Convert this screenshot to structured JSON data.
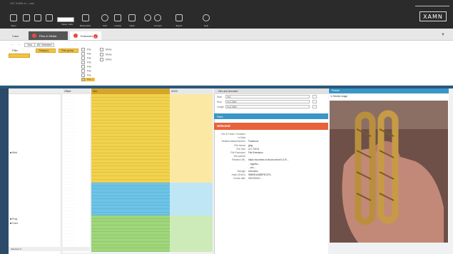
{
  "window": {
    "title": "XRY  XAMN 4.x  -  case"
  },
  "logo": "XAMN",
  "ribbon": {
    "buttons": [
      {
        "label": "Open"
      },
      {
        "label": ""
      },
      {
        "label": ""
      },
      {
        "label": "Views / tabs"
      },
      {
        "label": "Bookmarks"
      },
      {
        "label": "Find"
      },
      {
        "label": "Lookup"
      },
      {
        "label": "Hash"
      },
      {
        "label": "Convert"
      },
      {
        "label": "Export"
      },
      {
        "label": "Help"
      }
    ]
  },
  "tabs": {
    "home": "Case",
    "files": "Files & Media",
    "extended": "Extended 1"
  },
  "top_panel": {
    "nav": [
      "Back",
      "Forward"
    ],
    "buttons": [
      "Turn",
      "All / Selected"
    ],
    "filters": [
      "Filter",
      "Category",
      "Files group"
    ],
    "tree": [
      "File",
      "File",
      "File",
      "File",
      "File",
      "File",
      "File",
      "File",
      "File",
      "File 2"
    ],
    "right_tree": [
      "Mime",
      "Mime",
      "Mime"
    ]
  },
  "hex": {
    "column_header": "Offset",
    "hex_header": "Hex",
    "ascii_header": "ASCII"
  },
  "left_list": {
    "items": [
      "Mint",
      "Prop",
      "Cred"
    ]
  },
  "inspector": {
    "header": "Hex and decoded",
    "rows": [
      {
        "label": "Start",
        "value": "0x0"
      },
      {
        "label": "Stop",
        "value": "0x1CB84"
      },
      {
        "label": "Length",
        "value": "0x1CB85"
      }
    ],
    "file_bar": "Files",
    "selected_bar": "Selected",
    "details": [
      {
        "key": "File & Folder / Duration",
        "value": ""
      },
      {
        "key": "Is Data",
        "value": ""
      },
      {
        "key": "Related Attachment/url",
        "value": "Facebook"
      },
      {
        "key": "File format",
        "value": "jpeg"
      },
      {
        "key": "File Size",
        "value": "117,700 B"
      },
      {
        "key": "File Extension",
        "value": "File Extension"
      },
      {
        "key": "Recovered",
        "value": ""
      },
      {
        "key": "Related URL",
        "value": "https://scontent.xx.fbcdn.net/v/t1.0-9/..."
      },
      {
        "key": "",
        "value": "...mgcfhc..."
      },
      {
        "key": "",
        "value": "...oh=..."
      },
      {
        "key": "Storage",
        "value": "Unknown"
      },
      {
        "key": "Hash (SHA1)",
        "value": "96B9E4148BF5C2F4..."
      },
      {
        "key": "Create date",
        "value": "2017/02/10 ..."
      }
    ]
  },
  "preview": {
    "header": "Picture",
    "checkbox_label": "Stretch image"
  },
  "status": "Selected: 0",
  "colors": {
    "hex_yellow": "#f2d24c",
    "hex_blue": "#6cc4e8",
    "hex_green": "#9fd67a",
    "accent_blue": "#3b96c8",
    "accent_orange": "#e8613a"
  }
}
